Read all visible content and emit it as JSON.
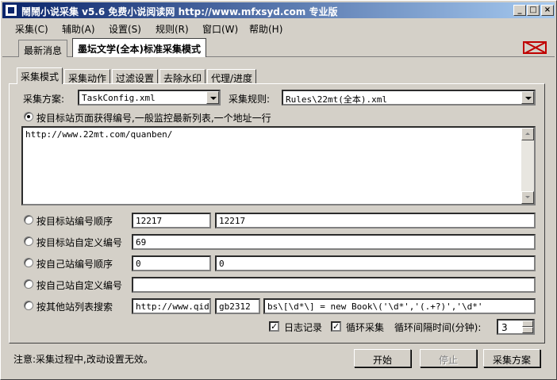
{
  "window": {
    "title": "鬧鬧小说采集 v5.6 免费小说阅读网 http://www.mfxsyd.com 专业版"
  },
  "titlebar": {
    "minimize_glyph": "_",
    "maximize_glyph": "□",
    "close_glyph": "×"
  },
  "menu": [
    {
      "label": "采集(C)"
    },
    {
      "label": "辅助(A)"
    },
    {
      "label": "设置(S)"
    },
    {
      "label": "规则(R)"
    },
    {
      "label": "窗口(W)"
    },
    {
      "label": "帮助(H)"
    }
  ],
  "doc_tabs": [
    {
      "label": "最新消息"
    },
    {
      "label": "墨坛文学(全本)标准采集模式",
      "active": true
    }
  ],
  "inner_tabs": [
    {
      "label": "采集模式",
      "active": true
    },
    {
      "label": "采集动作"
    },
    {
      "label": "过滤设置"
    },
    {
      "label": "去除水印"
    },
    {
      "label": "代理/进度"
    }
  ],
  "config": {
    "scheme_label": "采集方案:",
    "scheme_value": "TaskConfig.xml",
    "rule_label": "采集规则:",
    "rule_value": "Rules\\22mt(全本).xml"
  },
  "options": {
    "list_mode_label": "按目标站页面获得编号,一般监控最新列表,一个地址一行",
    "list_urls": "http://www.22mt.com/quanben/",
    "target_seq_label": "按目标站编号顺序",
    "target_seq_from": "12217",
    "target_seq_to": "12217",
    "target_custom_label": "按目标站自定义编号",
    "target_custom_value": "69",
    "own_seq_label": "按自己站编号顺序",
    "own_seq_from": "0",
    "own_seq_to": "0",
    "own_custom_label": "按自己站自定义编号",
    "own_custom_value": "",
    "other_search_label": "按其他站列表搜索",
    "other_search_url": "http://www.qidia",
    "other_search_encoding": "gb2312",
    "other_search_regex": "bs\\[\\d*\\] = new Book\\('\\d*','(.+?)','\\d*'"
  },
  "flags": {
    "log_label": "日志记录",
    "log_checked": true,
    "loop_label": "循环采集",
    "loop_checked": true,
    "interval_label": "循环间隔时间(分钟):",
    "interval_value": "3"
  },
  "footer": {
    "note": "注意:采集过程中,改动设置无效。",
    "start_label": "开始",
    "stop_label": "停止",
    "scheme_button_label": "采集方案"
  }
}
